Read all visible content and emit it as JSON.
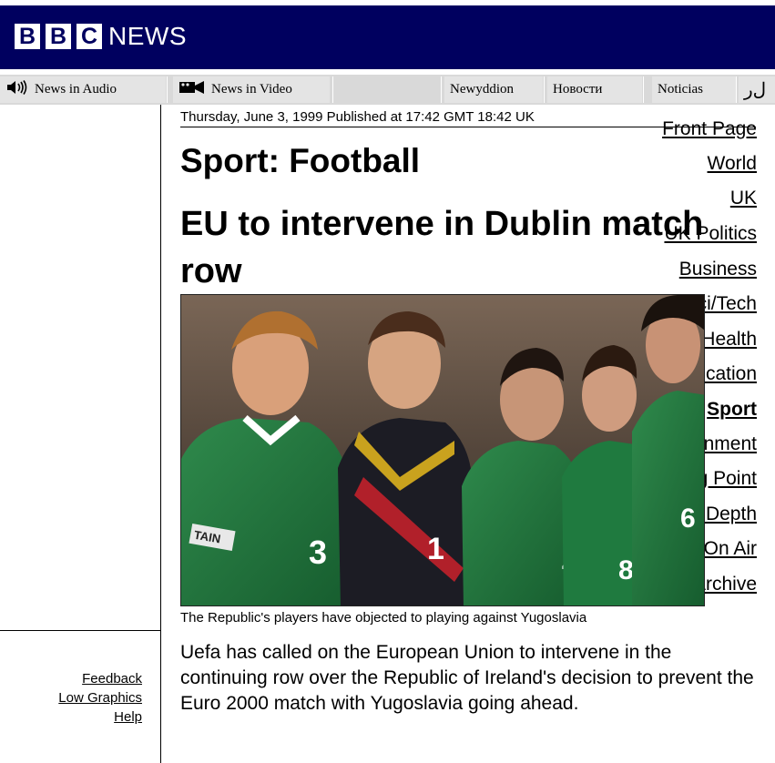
{
  "header": {
    "logo_letters": [
      "B",
      "B",
      "C"
    ],
    "logo_word": "NEWS",
    "bg_color": "#00005f"
  },
  "toolbar": {
    "audio_label": "News in Audio",
    "video_label": "News in Video",
    "languages": [
      "Newyddion",
      "Новости",
      "Noticias"
    ],
    "arabic_partial": "ﻝﺭ"
  },
  "nav": {
    "items": [
      "Front Page",
      "World",
      "UK",
      "UK Politics",
      "Business",
      "Sci/Tech",
      "Health",
      "Education",
      "Sport",
      "Entertainment",
      "Talking Point",
      "In Depth",
      "On Air",
      "Archive"
    ],
    "active": "Sport",
    "footer": [
      "Feedback",
      "Low Graphics",
      "Help"
    ]
  },
  "article": {
    "dateline": "Thursday, June 3, 1999 Published at 17:42 GMT 18:42 UK",
    "section": "Sport: Football",
    "headline": "EU to intervene in Dublin match row",
    "photo_caption": "The Republic's players have objected to playing against Yugoslavia",
    "body": "Uefa has called on the European Union to intervene in the continuing row over the Republic of Ireland's decision to prevent the Euro 2000 match with Yugoslavia going ahead."
  },
  "photo": {
    "shirt_numbers": [
      "3",
      "1",
      "4",
      "8",
      "6"
    ],
    "armband_text": "TAIN"
  }
}
